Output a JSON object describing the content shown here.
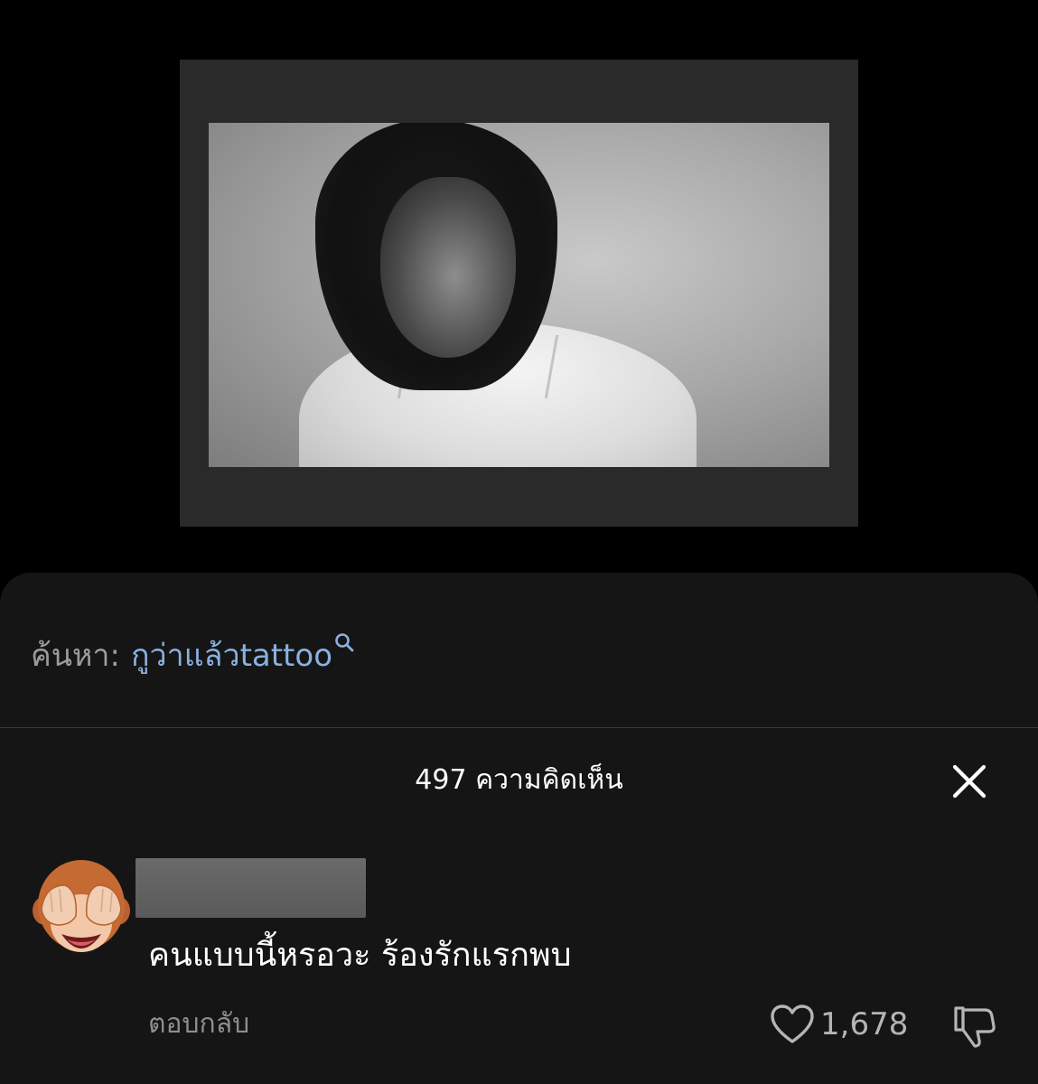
{
  "search": {
    "prefix": "ค้นหา:",
    "term": "กูว่าแล้วtattoo",
    "icon": "search-icon"
  },
  "comments_panel": {
    "title": "497 ความคิดเห็น",
    "close_icon": "close-icon"
  },
  "comment": {
    "avatar": "see-no-evil-monkey-emoji",
    "text": "คนแบบนี้หรอวะ ร้องรักแรกพบ",
    "reply_label": "ตอบกลับ",
    "like_count": "1,678",
    "like_icon": "heart-icon",
    "dislike_icon": "thumbs-down-icon"
  },
  "colors": {
    "link": "#8ab0e0",
    "sheet_bg": "#151515",
    "muted_text": "#8e8e8e"
  }
}
